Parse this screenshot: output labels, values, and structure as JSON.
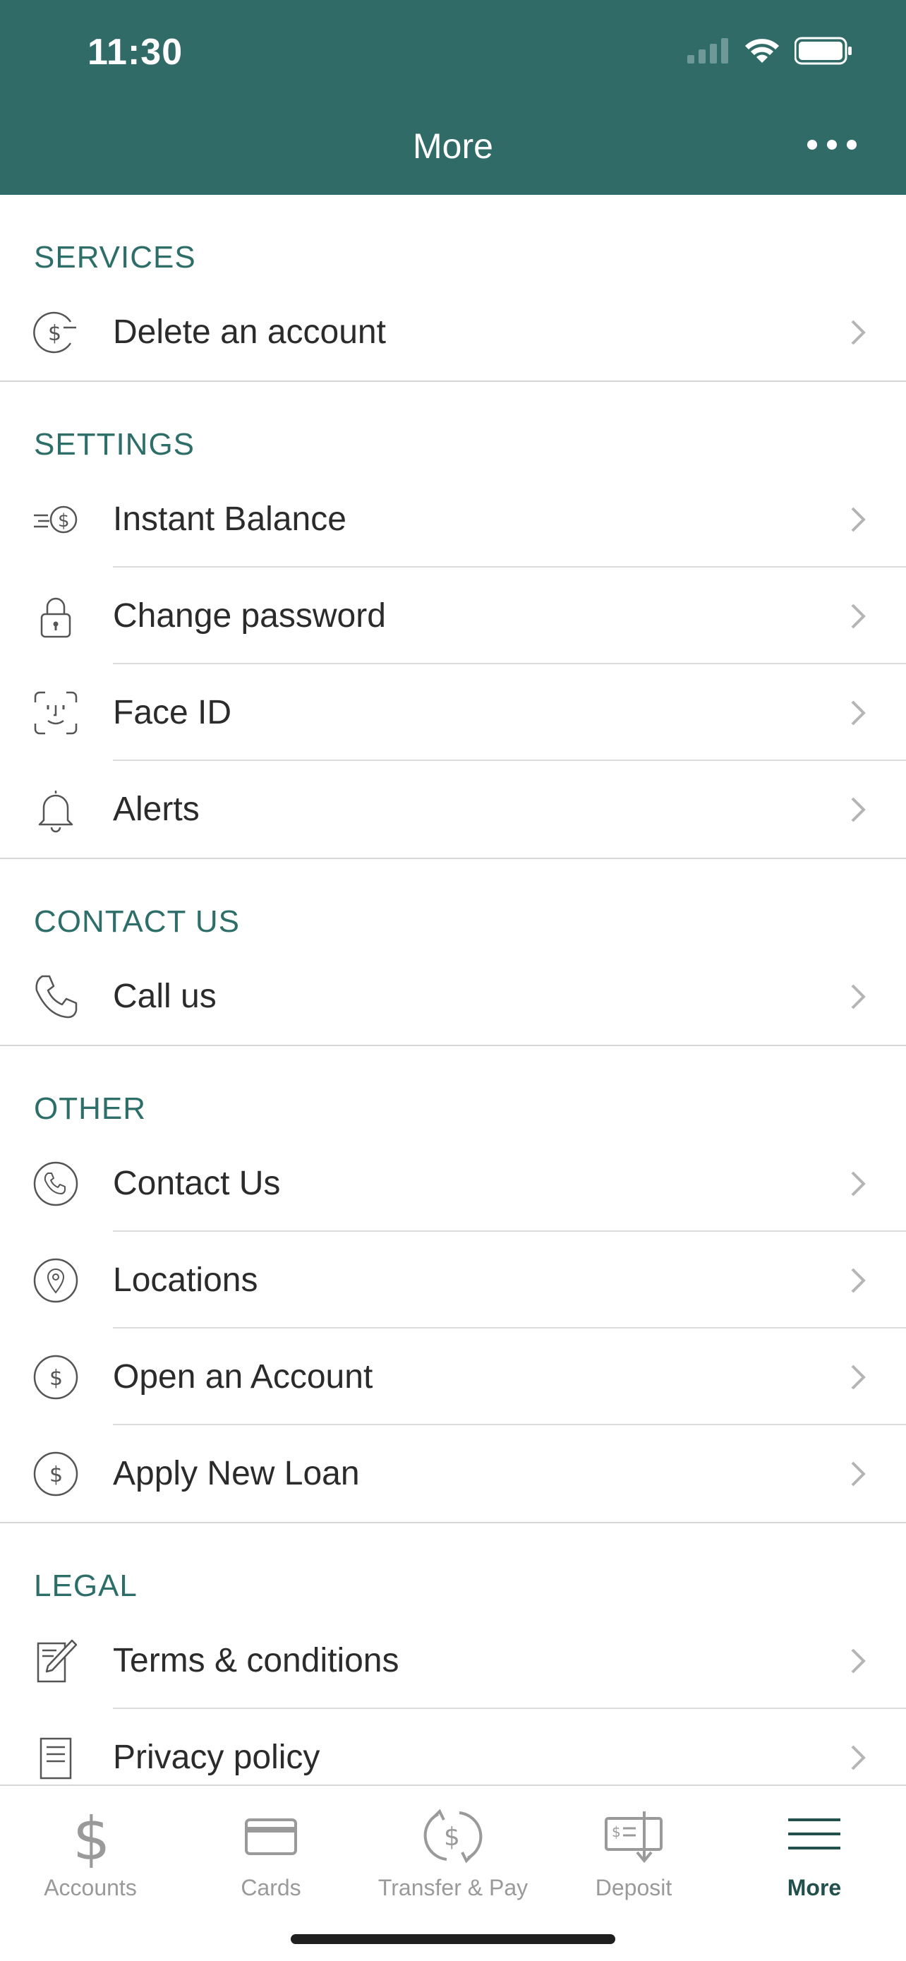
{
  "status": {
    "time": "11:30"
  },
  "header": {
    "title": "More"
  },
  "sections": {
    "services": {
      "title": "SERVICES",
      "items": [
        {
          "label": "Delete an account",
          "icon": "dollar-minus-icon"
        }
      ]
    },
    "settings": {
      "title": "SETTINGS",
      "items": [
        {
          "label": "Instant Balance",
          "icon": "instant-balance-icon"
        },
        {
          "label": "Change password",
          "icon": "lock-icon"
        },
        {
          "label": "Face ID",
          "icon": "face-id-icon"
        },
        {
          "label": "Alerts",
          "icon": "bell-icon"
        }
      ]
    },
    "contact": {
      "title": "CONTACT US",
      "items": [
        {
          "label": "Call us",
          "icon": "phone-icon"
        }
      ]
    },
    "other": {
      "title": "OTHER",
      "items": [
        {
          "label": "Contact Us",
          "icon": "phone-circle-icon"
        },
        {
          "label": "Locations",
          "icon": "location-pin-icon"
        },
        {
          "label": "Open an Account",
          "icon": "dollar-circle-icon"
        },
        {
          "label": "Apply New Loan",
          "icon": "dollar-circle-icon"
        }
      ]
    },
    "legal": {
      "title": "LEGAL",
      "items": [
        {
          "label": "Terms & conditions",
          "icon": "document-pen-icon"
        },
        {
          "label": "Privacy policy",
          "icon": "document-lines-icon"
        }
      ]
    }
  },
  "tabbar": {
    "tabs": [
      {
        "label": "Accounts",
        "icon": "dollar-icon"
      },
      {
        "label": "Cards",
        "icon": "card-icon"
      },
      {
        "label": "Transfer & Pay",
        "icon": "transfer-icon"
      },
      {
        "label": "Deposit",
        "icon": "deposit-check-icon"
      },
      {
        "label": "More",
        "icon": "menu-icon"
      }
    ],
    "active": "More"
  },
  "colors": {
    "header_bg": "#316b68",
    "section_title": "#2e6e69",
    "active_tab": "#21504d",
    "inactive_tab": "#9a9a9a"
  }
}
